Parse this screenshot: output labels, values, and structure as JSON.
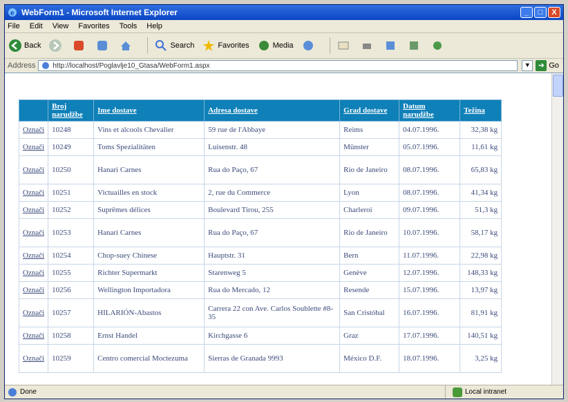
{
  "window": {
    "title": "WebForm1 - Microsoft Internet Explorer",
    "controls": [
      "_",
      "□",
      "X"
    ]
  },
  "menu": [
    "File",
    "Edit",
    "View",
    "Favorites",
    "Tools",
    "Help"
  ],
  "toolbar": {
    "back": "Back",
    "search": "Search",
    "favorites": "Favorites",
    "media": "Media"
  },
  "address": {
    "label": "Address",
    "url": "http://localhost/Poglavlje10_Gtasa/WebForm1.aspx",
    "go": "Go"
  },
  "grid": {
    "headers": [
      "",
      "Broj narudžbe",
      "Ime dostave",
      "Adresa dostave",
      "Grad dostave",
      "Datum narudžbe",
      "Težina"
    ],
    "select_label": "Označi",
    "rows": [
      {
        "broj": "10248",
        "ime": "Vins et alcools Chevalier",
        "adresa": "59 rue de l'Abbaye",
        "grad": "Reims",
        "datum": "04.07.1996.",
        "tezina": "32,38 kg"
      },
      {
        "broj": "10249",
        "ime": "Toms Spezialitäten",
        "adresa": "Luisenstr. 48",
        "grad": "Münster",
        "datum": "05.07.1996.",
        "tezina": "11,61 kg"
      },
      {
        "broj": "10250",
        "ime": "Hanari Carnes",
        "adresa": "Rua do Paço, 67",
        "grad": "Rio de Janeiro",
        "datum": "08.07.1996.",
        "tezina": "65,83 kg"
      },
      {
        "broj": "10251",
        "ime": "Victuailles en stock",
        "adresa": "2, rue du Commerce",
        "grad": "Lyon",
        "datum": "08.07.1996.",
        "tezina": "41,34 kg"
      },
      {
        "broj": "10252",
        "ime": "Suprêmes délices",
        "adresa": "Boulevard Tirou, 255",
        "grad": "Charleroi",
        "datum": "09.07.1996.",
        "tezina": "51,3 kg"
      },
      {
        "broj": "10253",
        "ime": "Hanari Carnes",
        "adresa": "Rua do Paço, 67",
        "grad": "Rio de Janeiro",
        "datum": "10.07.1996.",
        "tezina": "58,17 kg"
      },
      {
        "broj": "10254",
        "ime": "Chop-suey Chinese",
        "adresa": "Hauptstr. 31",
        "grad": "Bern",
        "datum": "11.07.1996.",
        "tezina": "22,98 kg"
      },
      {
        "broj": "10255",
        "ime": "Richter Supermarkt",
        "adresa": "Starenweg 5",
        "grad": "Genève",
        "datum": "12.07.1996.",
        "tezina": "148,33 kg"
      },
      {
        "broj": "10256",
        "ime": "Wellington Importadora",
        "adresa": "Rua do Mercado, 12",
        "grad": "Resende",
        "datum": "15.07.1996.",
        "tezina": "13,97 kg"
      },
      {
        "broj": "10257",
        "ime": "HILARIÓN-Abastos",
        "adresa": "Carrera 22 con Ave. Carlos Soublette #8-35",
        "grad": "San Cristóbal",
        "datum": "16.07.1996.",
        "tezina": "81,91 kg"
      },
      {
        "broj": "10258",
        "ime": "Ernst Handel",
        "adresa": "Kirchgasse 6",
        "grad": "Graz",
        "datum": "17.07.1996.",
        "tezina": "140,51 kg"
      },
      {
        "broj": "10259",
        "ime": "Centro comercial Moctezuma",
        "adresa": "Sierras de Granada 9993",
        "grad": "México D.F.",
        "datum": "18.07.1996.",
        "tezina": "3,25 kg"
      }
    ]
  },
  "status": {
    "left": "Done",
    "right": "Local intranet"
  },
  "colors": {
    "header_bg": "#0f80b8",
    "titlebar": "#0b46c4"
  }
}
